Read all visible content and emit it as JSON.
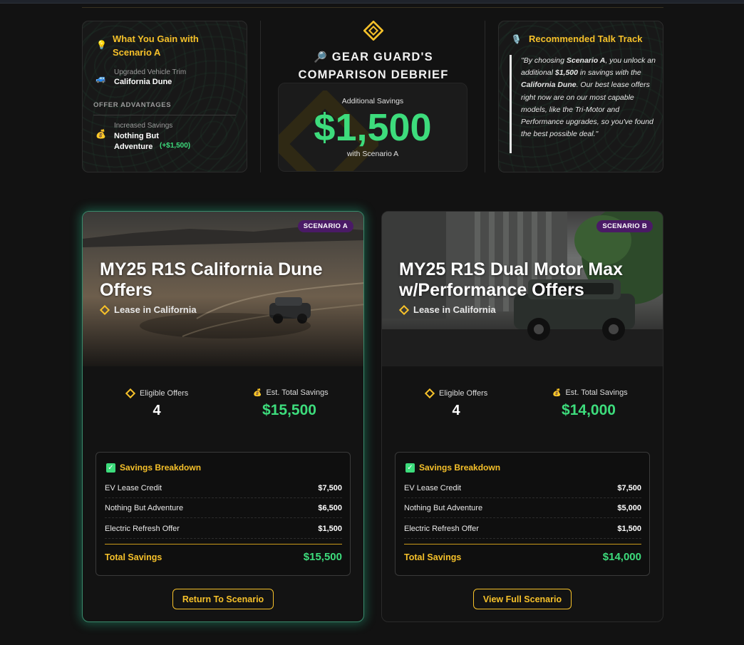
{
  "gain": {
    "title": "What You Gain with Scenario A",
    "trim_label": "Upgraded Vehicle Trim",
    "trim_value": "California Dune",
    "advantages_heading": "OFFER ADVANTAGES",
    "savings_label": "Increased Savings",
    "savings_name": "Nothing But Adventure",
    "savings_delta": "(+$1,500)",
    "icons": {
      "title": "lightbulb-icon",
      "trim": "car-icon",
      "savings": "money-bag-icon"
    }
  },
  "debrief": {
    "title": "GEAR GUARD'S COMPARISON DEBRIEF",
    "title_icon": "magnifier-icon",
    "savings_label": "Additional Savings",
    "savings_value": "$1,500",
    "savings_sub": "with Scenario A"
  },
  "talk": {
    "title": "Recommended Talk Track",
    "icon": "microphone-icon",
    "quote_1": "\"By choosing ",
    "quote_b1": "Scenario A",
    "quote_2": ", you unlock an additional ",
    "quote_b2": "$1,500",
    "quote_3": " in savings with the ",
    "quote_b3": "California Dune",
    "quote_4": ". Our best lease offers right now are on our most capable models, like the Tri-Motor and Performance upgrades, so you've found the best possible deal.\""
  },
  "cards": [
    {
      "badge": "SCENARIO A",
      "title": "MY25 R1S California Dune Offers",
      "lease": "Lease in California",
      "eligible_label": "Eligible Offers",
      "eligible_value": "4",
      "est_label": "Est. Total Savings",
      "est_value": "$15,500",
      "breakdown_title": "Savings Breakdown",
      "rows": [
        {
          "label": "EV Lease Credit",
          "amount": "$7,500"
        },
        {
          "label": "Nothing But Adventure",
          "amount": "$6,500"
        },
        {
          "label": "Electric Refresh Offer",
          "amount": "$1,500"
        }
      ],
      "total_label": "Total Savings",
      "total_value": "$15,500",
      "button": "Return To Scenario"
    },
    {
      "badge": "SCENARIO B",
      "title": "MY25 R1S Dual Motor Max w/Performance Offers",
      "lease": "Lease in California",
      "eligible_label": "Eligible Offers",
      "eligible_value": "4",
      "est_label": "Est. Total Savings",
      "est_value": "$14,000",
      "breakdown_title": "Savings Breakdown",
      "rows": [
        {
          "label": "EV Lease Credit",
          "amount": "$7,500"
        },
        {
          "label": "Nothing But Adventure",
          "amount": "$5,000"
        },
        {
          "label": "Electric Refresh Offer",
          "amount": "$1,500"
        }
      ],
      "total_label": "Total Savings",
      "total_value": "$14,000",
      "button": "View Full Scenario"
    }
  ],
  "colors": {
    "accent_gold": "#f6c12a",
    "savings_green": "#3ddc7c",
    "badge_purple": "#4a1a66",
    "glow_teal": "#3a8a6c"
  }
}
